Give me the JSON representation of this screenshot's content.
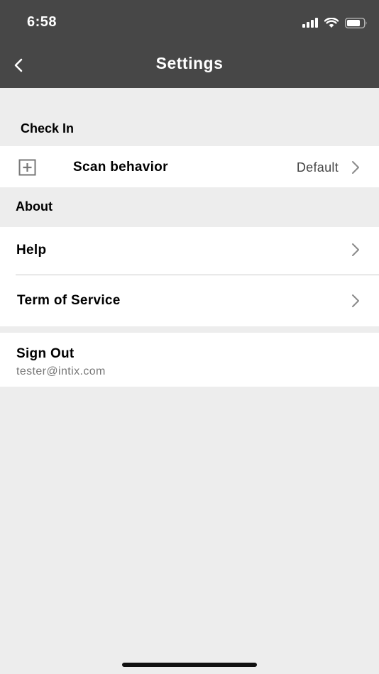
{
  "status_bar": {
    "time": "6:58",
    "icons": [
      "cellular-signal-icon",
      "wifi-icon",
      "battery-icon"
    ]
  },
  "nav": {
    "back_icon": "chevron-left-icon",
    "title": "Settings"
  },
  "sections": {
    "check_in": {
      "header": "Check In",
      "scan_behavior": {
        "icon": "plus-square-icon",
        "label": "Scan behavior",
        "value": "Default"
      }
    },
    "about": {
      "header": "About",
      "help": {
        "label": "Help"
      },
      "terms": {
        "label": "Term of Service"
      }
    },
    "account": {
      "sign_out_label": "Sign Out",
      "email": "tester@intix.com"
    }
  },
  "colors": {
    "header_bg": "#474747",
    "page_bg": "#ededed",
    "row_bg": "#ffffff",
    "chevron": "#8a8a8a"
  }
}
